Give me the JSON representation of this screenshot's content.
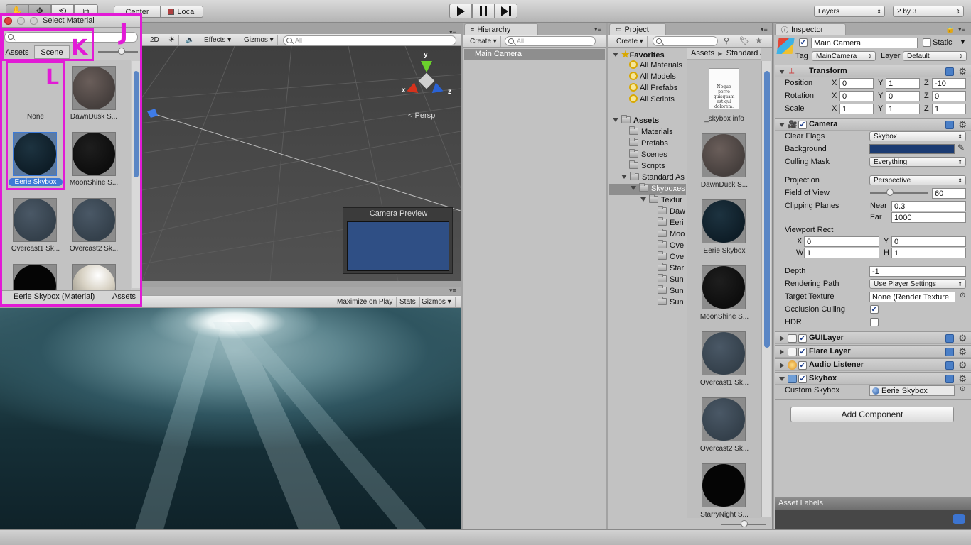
{
  "toolbar": {
    "center_label": "Center",
    "local_label": "Local",
    "layers_label": "Layers",
    "layout_label": "2 by 3"
  },
  "select_material": {
    "title": "Select Material",
    "tab_assets": "Assets",
    "tab_scene": "Scene",
    "items": [
      {
        "label": "None"
      },
      {
        "label": "DawnDusk S..."
      },
      {
        "label": "Eerie Skybox"
      },
      {
        "label": "MoonShine S..."
      },
      {
        "label": "Overcast1 Sk..."
      },
      {
        "label": "Overcast2 Sk..."
      }
    ],
    "footer_name": "Eerie Skybox (Material)",
    "footer_location": "Assets",
    "annotations": {
      "l": "L",
      "k": "K",
      "j": "J"
    }
  },
  "scene_view": {
    "mode_2d": "2D",
    "effects": "Effects",
    "gizmos": "Gizmos",
    "search_placeholder": "All",
    "gizmo_y": "y",
    "gizmo_x": "x",
    "gizmo_z": "z",
    "persp": "Persp",
    "camera_preview": "Camera Preview"
  },
  "game_view": {
    "maximize": "Maximize on Play",
    "stats": "Stats",
    "gizmos": "Gizmos"
  },
  "hierarchy": {
    "tab": "Hierarchy",
    "create": "Create",
    "search_placeholder": "All",
    "items": [
      "Main Camera"
    ]
  },
  "project": {
    "tab": "Project",
    "create": "Create",
    "favorites": "Favorites",
    "favorite_items": [
      "All Materials",
      "All Models",
      "All Prefabs",
      "All Scripts"
    ],
    "assets": "Assets",
    "asset_folders": [
      "Materials",
      "Prefabs",
      "Scenes",
      "Scripts",
      "Standard As"
    ],
    "skyboxes": "Skyboxes",
    "textures": "Textur",
    "texture_folders": [
      "Daw",
      "Eeri",
      "Moo",
      "Ove",
      "Ove",
      "Star",
      "Sun",
      "Sun",
      "Sun"
    ],
    "breadcrumb_assets": "Assets",
    "breadcrumb_standard": "Standard A",
    "grid_items": [
      {
        "label": "_skybox info",
        "doc_text": "Neque porro quisquam est qui dolorem."
      },
      {
        "label": "DawnDusk S..."
      },
      {
        "label": "Eerie Skybox"
      },
      {
        "label": "MoonShine S..."
      },
      {
        "label": "Overcast1 Sk..."
      },
      {
        "label": "Overcast2 Sk..."
      },
      {
        "label": "StarryNight S..."
      }
    ]
  },
  "inspector": {
    "tab": "Inspector",
    "object_name": "Main Camera",
    "static_label": "Static",
    "tag_label": "Tag",
    "tag_value": "MainCamera",
    "layer_label": "Layer",
    "layer_value": "Default",
    "transform": {
      "title": "Transform",
      "position_label": "Position",
      "rotation_label": "Rotation",
      "scale_label": "Scale",
      "x": "X",
      "y": "Y",
      "z": "Z",
      "position": [
        "0",
        "1",
        "-10"
      ],
      "rotation": [
        "0",
        "0",
        "0"
      ],
      "scale": [
        "1",
        "1",
        "1"
      ]
    },
    "camera": {
      "title": "Camera",
      "clear_flags_label": "Clear Flags",
      "clear_flags": "Skybox",
      "background_label": "Background",
      "culling_mask_label": "Culling Mask",
      "culling_mask": "Everything",
      "projection_label": "Projection",
      "projection": "Perspective",
      "fov_label": "Field of View",
      "fov": "60",
      "clipping_label": "Clipping Planes",
      "near_label": "Near",
      "near": "0.3",
      "far_label": "Far",
      "far": "1000",
      "viewport_label": "Viewport Rect",
      "vx_label": "X",
      "vx": "0",
      "vy_label": "Y",
      "vy": "0",
      "vw_label": "W",
      "vw": "1",
      "vh_label": "H",
      "vh": "1",
      "depth_label": "Depth",
      "depth": "-1",
      "rendering_label": "Rendering Path",
      "rendering": "Use Player Settings",
      "target_label": "Target Texture",
      "target": "None (Render Texture",
      "occlusion_label": "Occlusion Culling",
      "hdr_label": "HDR"
    },
    "guilayer": "GUILayer",
    "flare_layer": "Flare Layer",
    "audio_listener": "Audio Listener",
    "skybox": {
      "title": "Skybox",
      "custom_label": "Custom Skybox",
      "custom_value": "Eerie Skybox"
    },
    "add_component": "Add Component",
    "asset_labels": "Asset Labels"
  },
  "colors": {
    "camera_background": "#1b3b72",
    "preview_blue": "#2f4f85",
    "selection_blue": "#3d7ad6",
    "annotation_magenta": "#e21ad6"
  }
}
